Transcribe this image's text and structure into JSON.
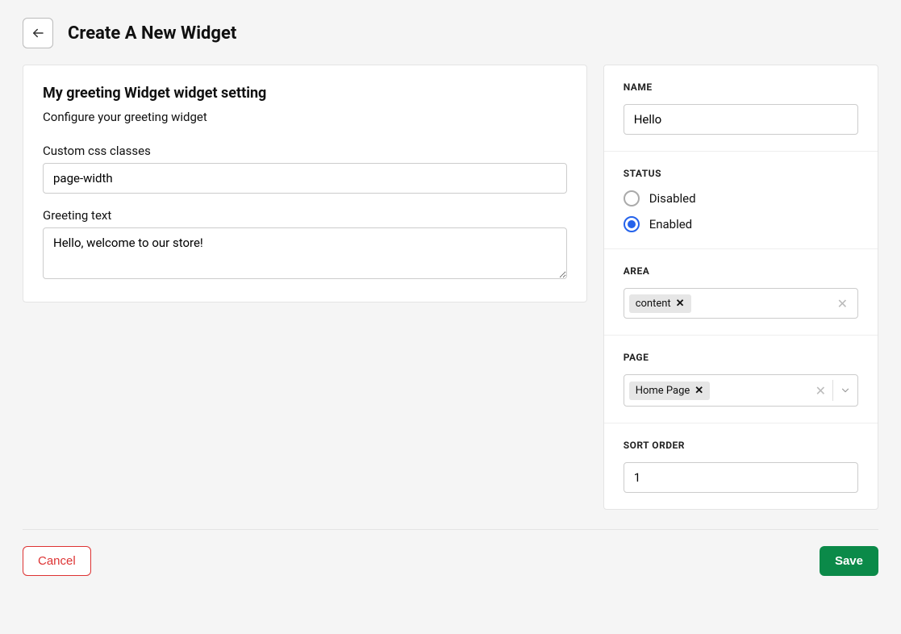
{
  "header": {
    "title": "Create A New Widget"
  },
  "main": {
    "title": "My greeting Widget widget setting",
    "description": "Configure your greeting widget",
    "css": {
      "label": "Custom css classes",
      "value": "page-width"
    },
    "greeting": {
      "label": "Greeting text",
      "value": "Hello, welcome to our store!"
    }
  },
  "side": {
    "name": {
      "label": "NAME",
      "value": "Hello"
    },
    "status": {
      "label": "STATUS",
      "options": {
        "disabled": "Disabled",
        "enabled": "Enabled"
      },
      "selected": "enabled"
    },
    "area": {
      "label": "AREA",
      "tag": "content"
    },
    "page": {
      "label": "PAGE",
      "tag": "Home Page"
    },
    "sort": {
      "label": "SORT ORDER",
      "value": "1"
    }
  },
  "footer": {
    "cancel": "Cancel",
    "save": "Save"
  }
}
